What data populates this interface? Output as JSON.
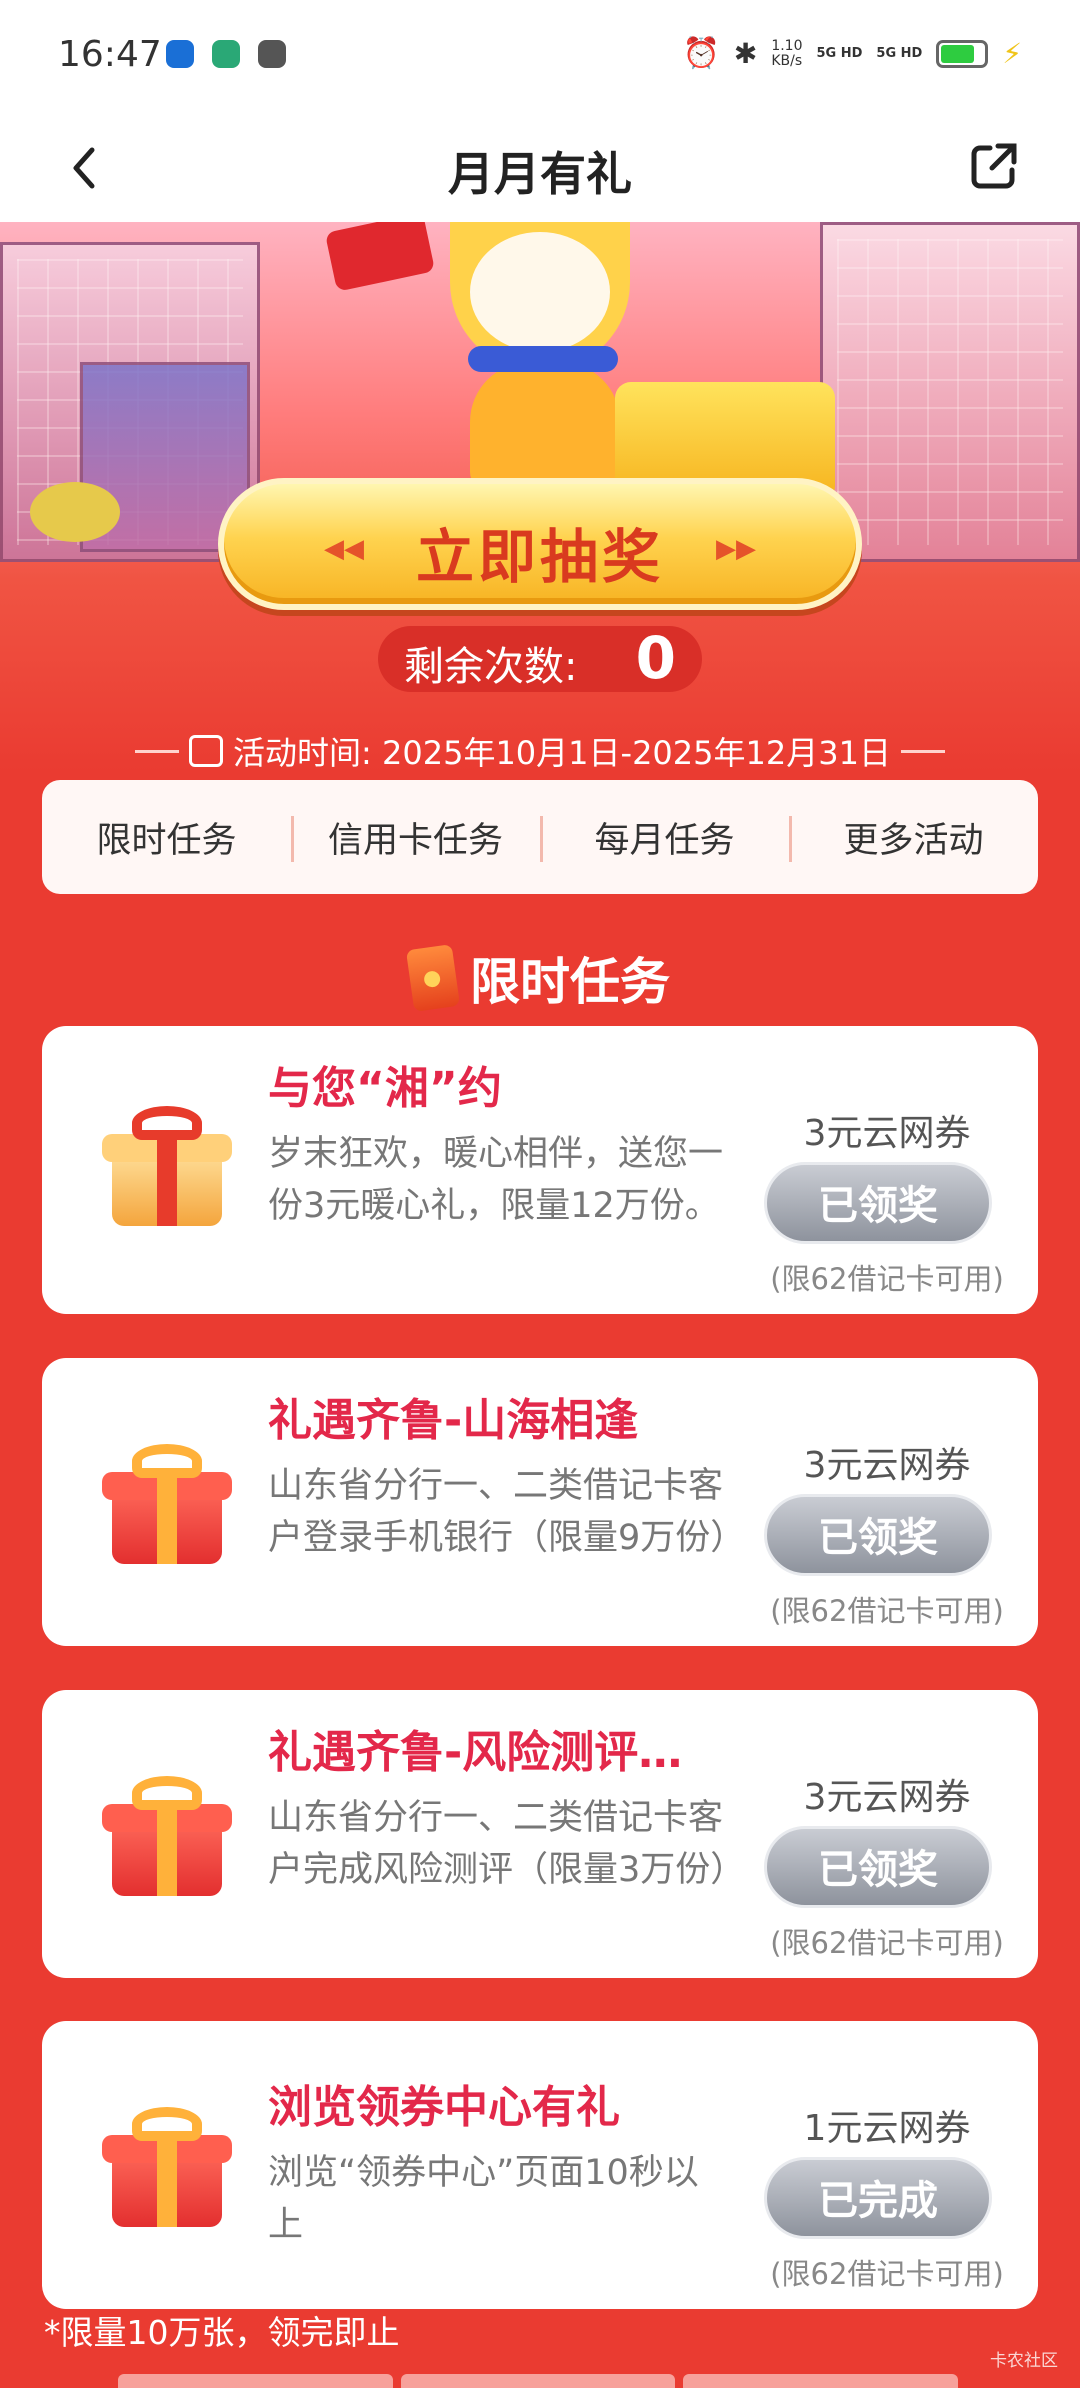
{
  "status_bar": {
    "time": "16:47",
    "network_speed": "1.10\nKB/s",
    "signal1": "5G HD",
    "signal2": "5G HD",
    "battery_color": "#2ecc40"
  },
  "nav": {
    "title": "月月有礼",
    "back_icon": "chevron-left-icon",
    "share_icon": "share-icon"
  },
  "hero": {
    "draw_button": "立即抽奖",
    "remaining_label": "剩余次数:",
    "remaining_count": "0",
    "period": "活动时间: 2025年10月1日-2025年12月31日"
  },
  "tabs": [
    {
      "label": "限时任务"
    },
    {
      "label": "信用卡任务"
    },
    {
      "label": "每月任务"
    },
    {
      "label": "更多活动"
    }
  ],
  "section_title": "限时任务",
  "tasks": [
    {
      "title": "与您“湘”约",
      "desc": "岁末狂欢，暖心相伴，送您一份3元暖心礼，限量12万份。",
      "reward": "3元云网券",
      "button": "已领奖",
      "limit": "(限62借记卡可用)"
    },
    {
      "title": "礼遇齐鲁-山海相逢",
      "desc": "山东省分行一、二类借记卡客户登录手机银行（限量9万份）",
      "reward": "3元云网券",
      "button": "已领奖",
      "limit": "(限62借记卡可用)"
    },
    {
      "title": "礼遇齐鲁-风险测评…",
      "desc": "山东省分行一、二类借记卡客户完成风险测评（限量3万份）",
      "reward": "3元云网券",
      "button": "已领奖",
      "limit": "(限62借记卡可用)"
    },
    {
      "title": "浏览领券中心有礼",
      "desc": "浏览“领券中心”页面10秒以上",
      "reward": "1元云网券",
      "button": "已完成",
      "limit": "(限62借记卡可用)"
    }
  ],
  "footnote": "*限量10万张，领完即止",
  "watermark": "卡农社区",
  "colors": {
    "accent": "#e3284a",
    "background": "#ea3b31",
    "button_gray": "#8e939d"
  }
}
